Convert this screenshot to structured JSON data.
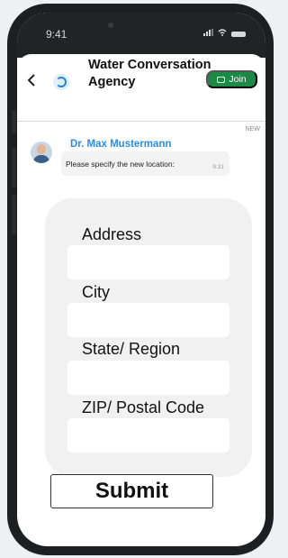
{
  "status_bar": {
    "time": "9:41",
    "signal_icon": "signal-icon",
    "wifi_icon": "wifi-icon",
    "battery_icon": "battery-icon"
  },
  "header": {
    "back_icon": "chevron-left-icon",
    "logo_icon": "agency-logo-icon",
    "agency_name": "Water Conversation Agency",
    "join_label": "Join",
    "join_color": "#1b8a46"
  },
  "new_marker": "NEW",
  "message": {
    "sender": "Dr. Max Mustermann",
    "sender_color": "#2a8ee0",
    "text": "Please specify the new location:",
    "time": "9:31"
  },
  "form": {
    "fields": [
      {
        "label": "Address",
        "value": ""
      },
      {
        "label": "City",
        "value": ""
      },
      {
        "label": "State/ Region",
        "value": ""
      },
      {
        "label": "ZIP/ Postal Code",
        "value": ""
      }
    ],
    "submit_label": "Submit"
  }
}
